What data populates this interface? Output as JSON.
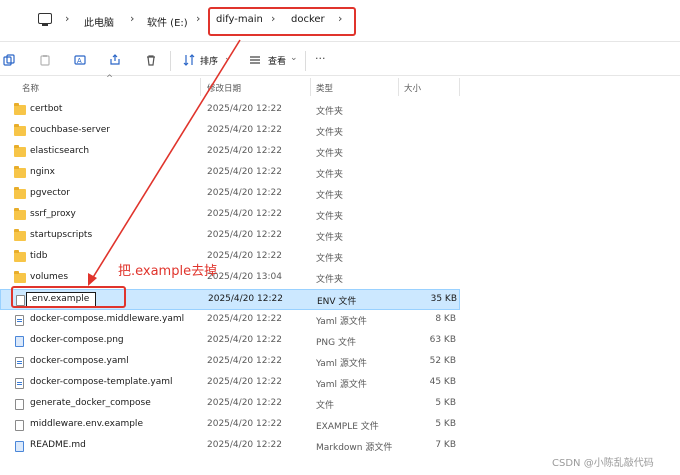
{
  "breadcrumb": {
    "items": [
      "此电脑",
      "软件 (E:)",
      "dify-main",
      "docker"
    ]
  },
  "toolbar": {
    "sort_label": "排序",
    "view_label": "查看"
  },
  "header": {
    "name": "名称",
    "date": "修改日期",
    "type": "类型",
    "size": "大小"
  },
  "files": [
    {
      "name": "certbot",
      "date": "2025/4/20 12:22",
      "type": "文件夹",
      "size": "",
      "icon": "folder-icon"
    },
    {
      "name": "couchbase-server",
      "date": "2025/4/20 12:22",
      "type": "文件夹",
      "size": "",
      "icon": "folder-icon"
    },
    {
      "name": "elasticsearch",
      "date": "2025/4/20 12:22",
      "type": "文件夹",
      "size": "",
      "icon": "folder-icon"
    },
    {
      "name": "nginx",
      "date": "2025/4/20 12:22",
      "type": "文件夹",
      "size": "",
      "icon": "folder-icon"
    },
    {
      "name": "pgvector",
      "date": "2025/4/20 12:22",
      "type": "文件夹",
      "size": "",
      "icon": "folder-icon"
    },
    {
      "name": "ssrf_proxy",
      "date": "2025/4/20 12:22",
      "type": "文件夹",
      "size": "",
      "icon": "folder-icon"
    },
    {
      "name": "startupscripts",
      "date": "2025/4/20 12:22",
      "type": "文件夹",
      "size": "",
      "icon": "folder-icon"
    },
    {
      "name": "tidb",
      "date": "2025/4/20 12:22",
      "type": "文件夹",
      "size": "",
      "icon": "folder-icon"
    },
    {
      "name": "volumes",
      "date": "2025/4/20 13:04",
      "type": "文件夹",
      "size": "",
      "icon": "folder-icon"
    },
    {
      "name": ".env.example",
      "date": "2025/4/20 12:22",
      "type": "ENV 文件",
      "size": "35 KB",
      "icon": "file-icon"
    },
    {
      "name": "docker-compose.middleware.yaml",
      "date": "2025/4/20 12:22",
      "type": "Yaml 源文件",
      "size": "8 KB",
      "icon": "yaml-file-icon"
    },
    {
      "name": "docker-compose.png",
      "date": "2025/4/20 12:22",
      "type": "PNG 文件",
      "size": "63 KB",
      "icon": "image-file-icon"
    },
    {
      "name": "docker-compose.yaml",
      "date": "2025/4/20 12:22",
      "type": "Yaml 源文件",
      "size": "52 KB",
      "icon": "yaml-file-icon"
    },
    {
      "name": "docker-compose-template.yaml",
      "date": "2025/4/20 12:22",
      "type": "Yaml 源文件",
      "size": "45 KB",
      "icon": "yaml-file-icon"
    },
    {
      "name": "generate_docker_compose",
      "date": "2025/4/20 12:22",
      "type": "文件",
      "size": "5 KB",
      "icon": "file-icon"
    },
    {
      "name": "middleware.env.example",
      "date": "2025/4/20 12:22",
      "type": "EXAMPLE 文件",
      "size": "5 KB",
      "icon": "file-icon"
    },
    {
      "name": "README.md",
      "date": "2025/4/20 12:22",
      "type": "Markdown 源文件",
      "size": "7 KB",
      "icon": "markdown-file-icon"
    }
  ],
  "annotation": {
    "text": "把.example去掉",
    "color": "#e0342c"
  },
  "selection_color": "#cce8ff",
  "watermark": "CSDN @小陈乱敲代码"
}
